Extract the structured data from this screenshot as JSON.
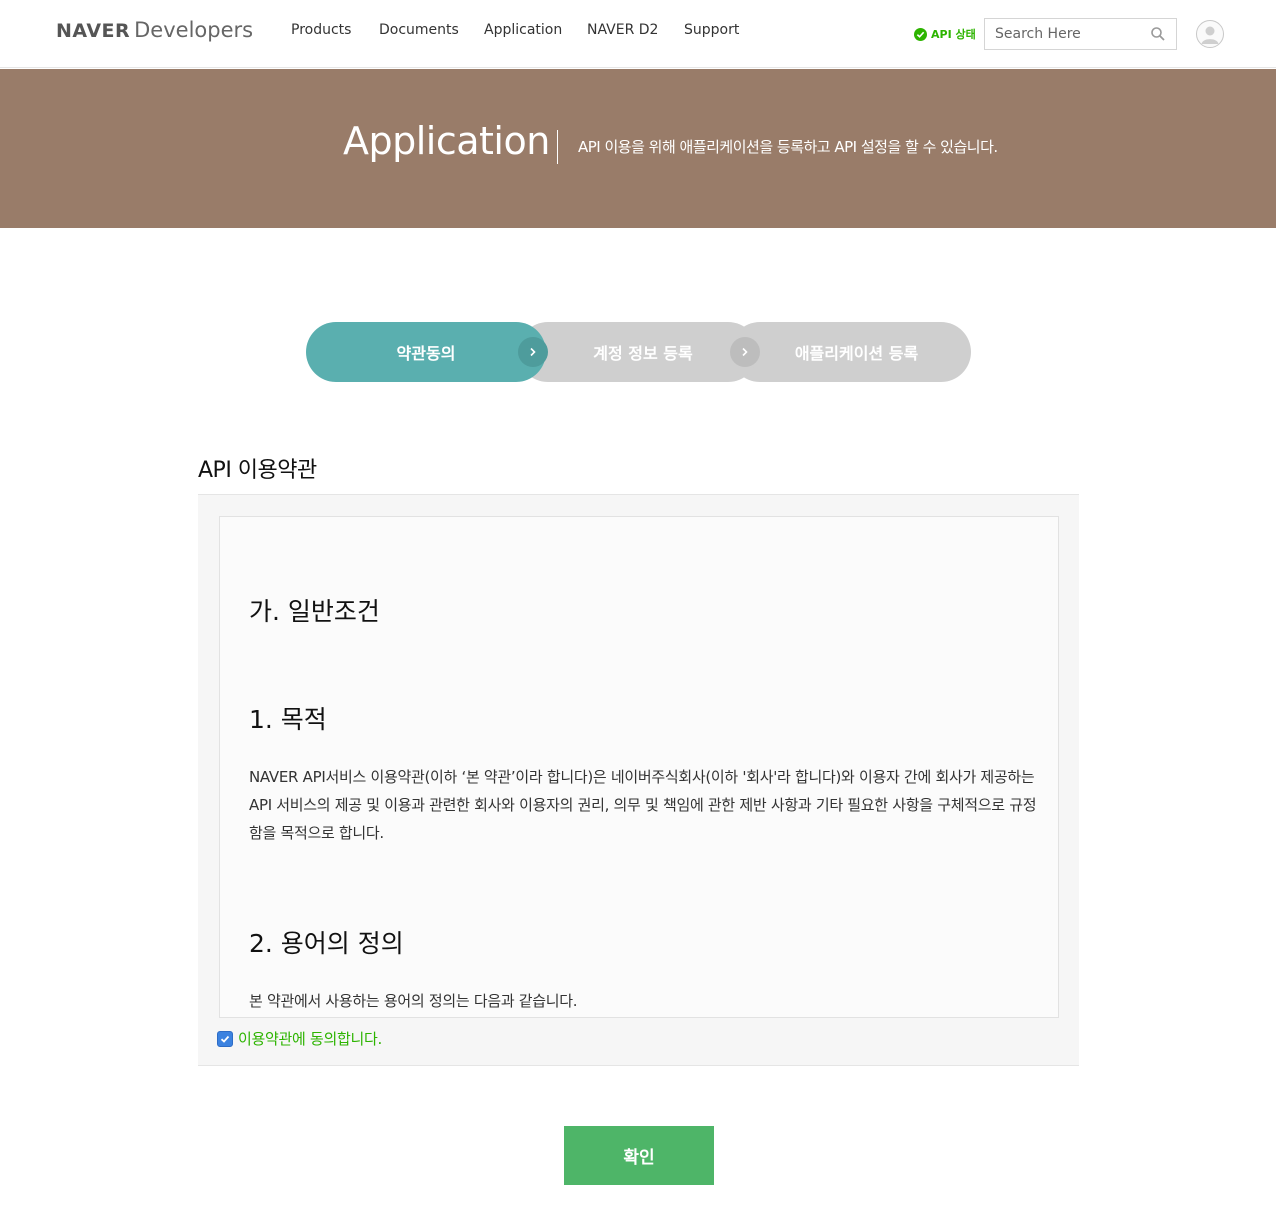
{
  "header": {
    "logo_naver": "NAVER",
    "logo_developers": "Developers",
    "nav": [
      "Products",
      "Documents",
      "Application",
      "NAVER D2",
      "Support"
    ],
    "api_status": "API 상태",
    "api_status_color": "#2db400",
    "search_placeholder": "Search Here",
    "search_icon": "search-icon",
    "avatar_icon": "user-icon"
  },
  "banner": {
    "title": "Application",
    "description": "API 이용을 위해 애플리케이션을 등록하고 API 설정을 할 수 있습니다.",
    "background": "#997c69"
  },
  "steps": {
    "items": [
      "약관동의",
      "계정 정보 등록",
      "애플리케이션 등록"
    ],
    "active_index": 0,
    "active_color": "#5aafaf",
    "inactive_color": "#cfcfcf"
  },
  "terms": {
    "title": "API 이용약관",
    "section_heading": "가. 일반조건",
    "h1": "1. 목적",
    "p1": "NAVER API서비스 이용약관(이하 ‘본 약관’이라 합니다)은 네이버주식회사(이하 '회사'라 합니다)와 이용자 간에 회사가 제공하는 API 서비스의 제공 및 이용과 관련한 회사와 이용자의 권리, 의무 및 책임에 관한 제반 사항과 기타 필요한 사항을 구체적으로 규정함을 목적으로 합니다.",
    "h2": "2. 용어의 정의",
    "p2": "본 약관에서 사용하는 용어의 정의는 다음과 같습니다."
  },
  "agree": {
    "label": "이용약관에 동의합니다.",
    "checked": true
  },
  "confirm_button": {
    "label": "확인",
    "color": "#4eb568"
  }
}
